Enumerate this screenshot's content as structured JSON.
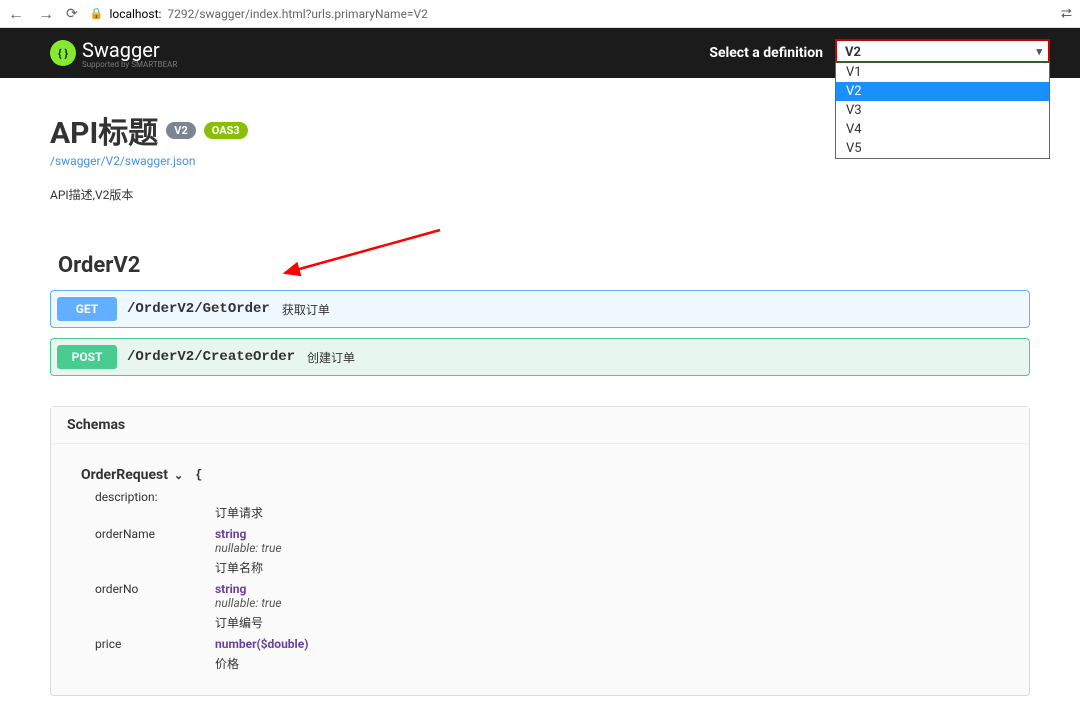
{
  "browser": {
    "url_host": "localhost:",
    "url_port_path": "7292/swagger/index.html?urls.primaryName=V2"
  },
  "topbar": {
    "logo_text": "Swagger",
    "logo_sub": "Supported by SMARTBEAR",
    "def_label": "Select a definition",
    "selected": "V2",
    "options": [
      "V1",
      "V2",
      "V3",
      "V4",
      "V5"
    ]
  },
  "info": {
    "title": "API标题",
    "version": "V2",
    "oas": "OAS3",
    "spec_link": "/swagger/V2/swagger.json",
    "description": "API描述,V2版本"
  },
  "tag": {
    "name": "OrderV2"
  },
  "operations": [
    {
      "method": "GET",
      "path": "/OrderV2/GetOrder",
      "summary": "获取订单"
    },
    {
      "method": "POST",
      "path": "/OrderV2/CreateOrder",
      "summary": "创建订单"
    }
  ],
  "schemas": {
    "header": "Schemas",
    "model_name": "OrderRequest",
    "desc_label": "description:",
    "desc_value": "订单请求",
    "props": [
      {
        "name": "orderName",
        "type": "string",
        "nullable": "nullable: true",
        "desc": "订单名称"
      },
      {
        "name": "orderNo",
        "type": "string",
        "nullable": "nullable: true",
        "desc": "订单编号"
      },
      {
        "name": "price",
        "type": "number($double)",
        "nullable": "",
        "desc": "价格"
      }
    ]
  }
}
